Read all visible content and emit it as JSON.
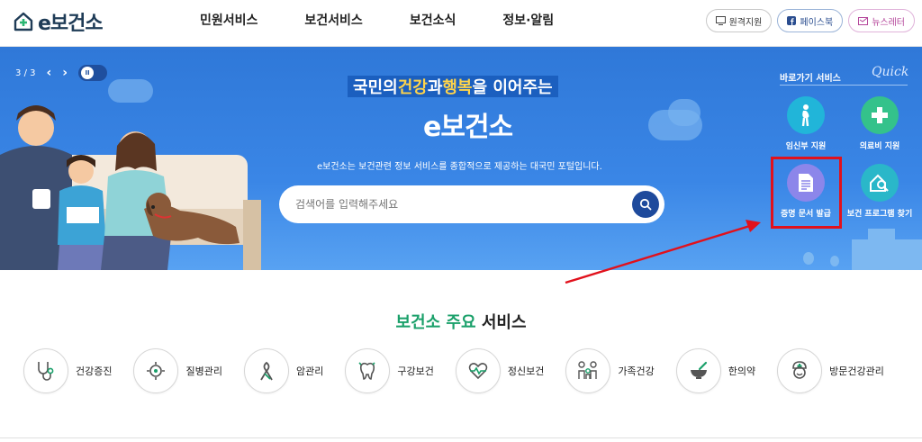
{
  "header": {
    "logo_text": "e보건소",
    "nav": [
      "민원서비스",
      "보건서비스",
      "보건소식",
      "정보·알림"
    ],
    "util": [
      {
        "label": "원격지원",
        "icon": "monitor-icon"
      },
      {
        "label": "페이스북",
        "icon": "facebook-icon"
      },
      {
        "label": "뉴스레터",
        "icon": "newsletter-icon"
      }
    ]
  },
  "hero": {
    "pager": {
      "current": "3",
      "separator": "/",
      "total": "3"
    },
    "tagline": {
      "pre": "국민의 ",
      "hl1": "건강",
      "mid": " 과 ",
      "hl2": "행복",
      "post": " 을 이어주는"
    },
    "title": "e보건소",
    "subtitle": "e보건소는 보건관련 정보 서비스를 종합적으로 제공하는 대국민 포털입니다.",
    "search": {
      "placeholder": "검색어를 입력해주세요"
    }
  },
  "quick": {
    "heading": "바로가기 서비스",
    "script": "Quick",
    "items": [
      {
        "label": "임신부 지원",
        "color": "#21b5d9",
        "icon": "pregnant-icon"
      },
      {
        "label": "의료비 지원",
        "color": "#34c28b",
        "icon": "medical-cross-icon"
      },
      {
        "label": "증명 문서 발급",
        "color": "#8c86ea",
        "icon": "document-icon"
      },
      {
        "label": "보건 프로그램 찾기",
        "color": "#2ab7c9",
        "icon": "program-search-icon"
      }
    ]
  },
  "services": {
    "title_hl": "보건소 주요",
    "title_rest": " 서비스",
    "items": [
      {
        "label": "건강증진",
        "icon": "stethoscope-icon"
      },
      {
        "label": "질병관리",
        "icon": "virus-icon"
      },
      {
        "label": "암관리",
        "icon": "ribbon-icon"
      },
      {
        "label": "구강보건",
        "icon": "tooth-icon"
      },
      {
        "label": "정신보건",
        "icon": "heart-pulse-icon"
      },
      {
        "label": "가족건강",
        "icon": "family-icon"
      },
      {
        "label": "한의약",
        "icon": "mortar-icon"
      },
      {
        "label": "방문건강관리",
        "icon": "nurse-icon"
      }
    ]
  },
  "colors": {
    "brand_blue": "#2f78d8",
    "accent_green": "#1aa06a",
    "annotation_red": "#e1111c"
  }
}
